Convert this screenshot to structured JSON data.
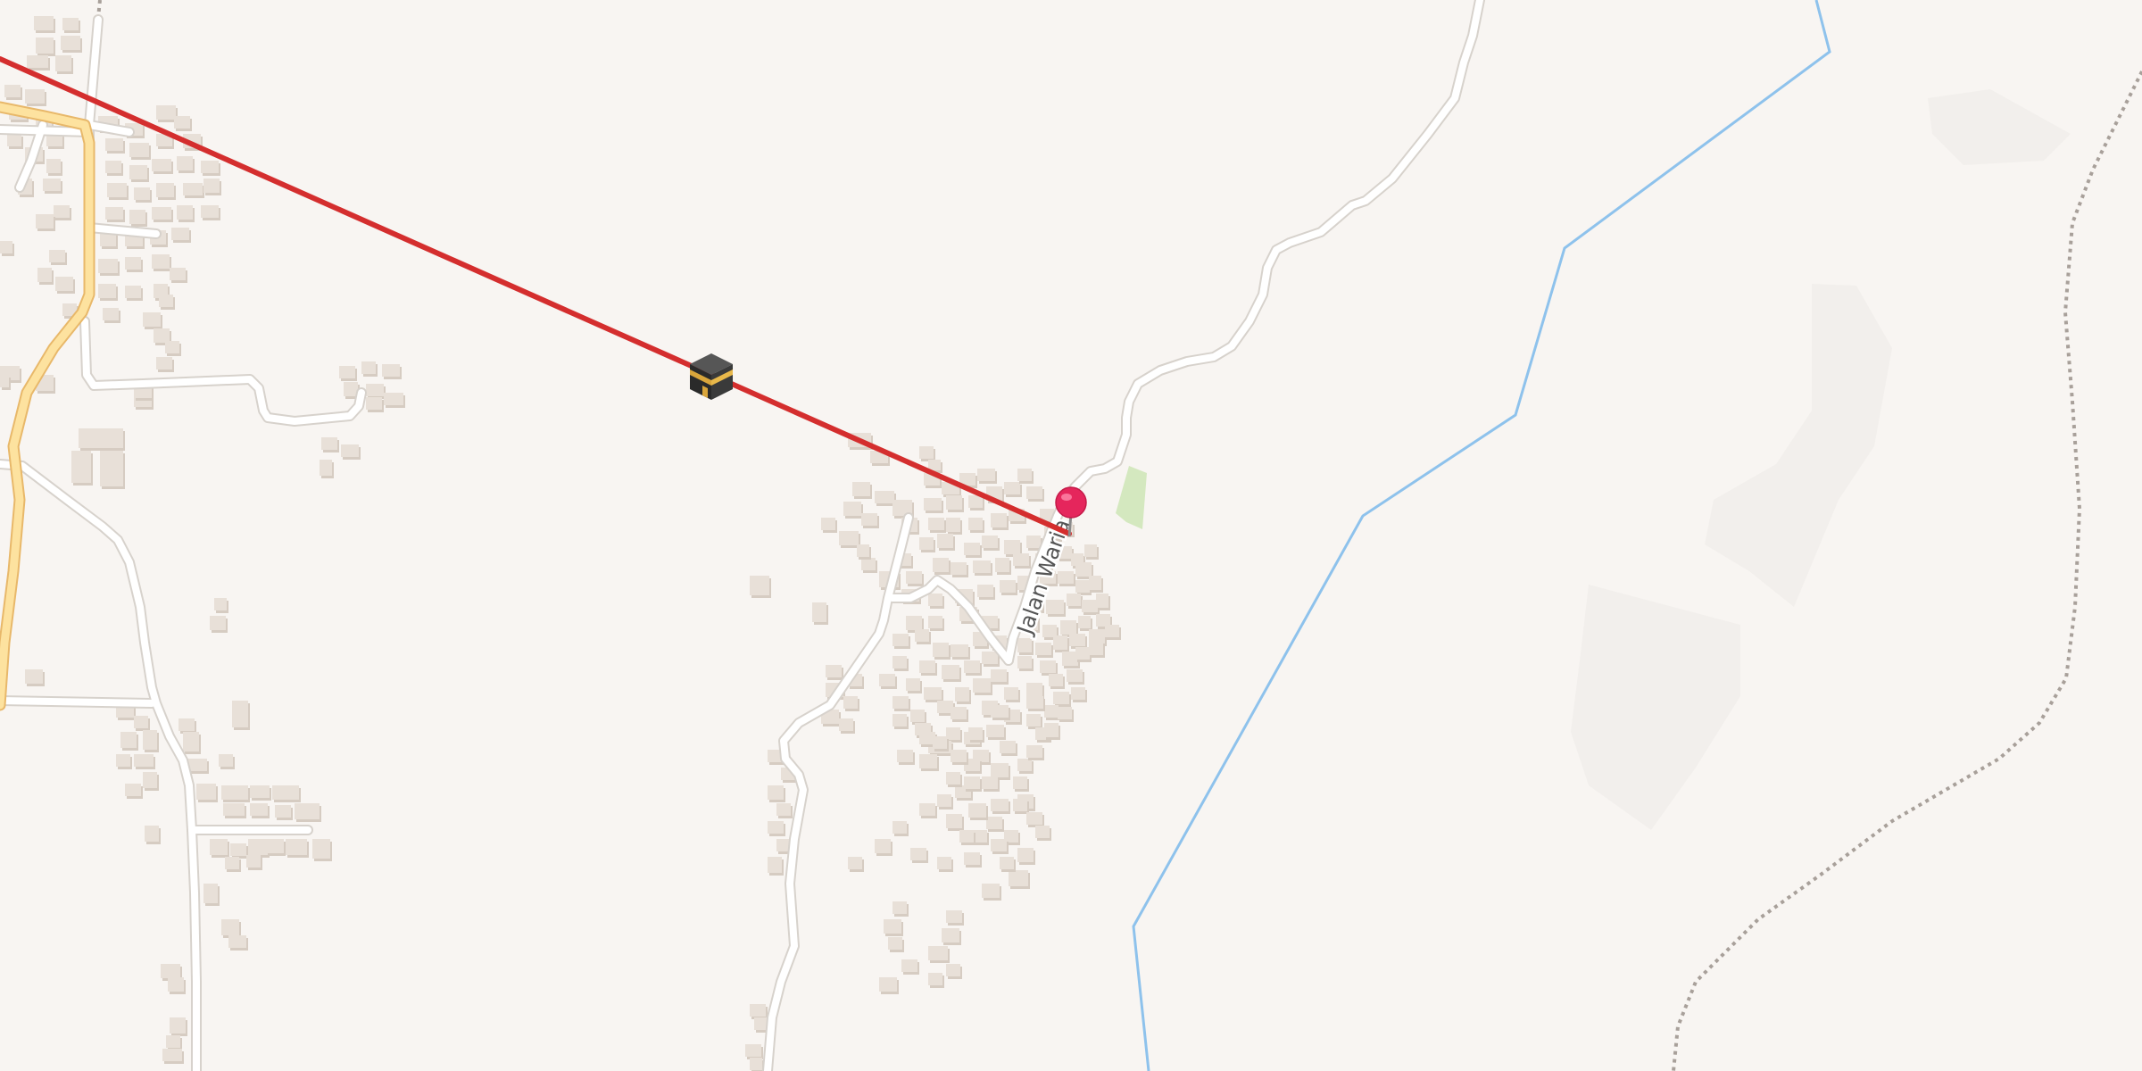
{
  "map": {
    "street_labels": [
      "Jalan Waria"
    ],
    "kaaba_icon": "kaaba-icon",
    "pin_icon": "location-pin-icon",
    "colors": {
      "background": "#f8f5f2",
      "qibla_line": "#d42e2e",
      "road_major": "#fde29f",
      "road_major_casing": "#e8b86a",
      "road_minor": "#ffffff",
      "road_minor_casing": "#d7d2cc",
      "building": "#e8e0d8",
      "building_shadow": "#d6ccc2",
      "boundary": "#8ec2ec",
      "track": "#a8a09a",
      "park": "#d4e8bf",
      "pin": "#e5265c"
    }
  }
}
